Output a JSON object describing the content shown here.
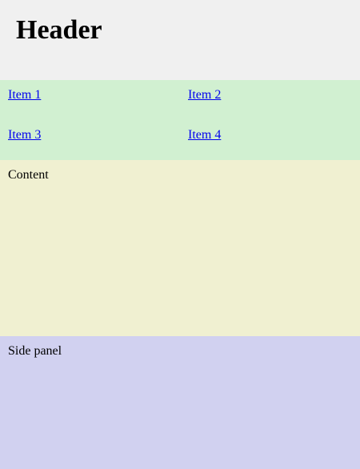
{
  "header": {
    "title": "Header"
  },
  "nav": {
    "items": [
      {
        "label": "Item 1"
      },
      {
        "label": "Item 2"
      },
      {
        "label": "Item 3"
      },
      {
        "label": "Item 4"
      }
    ]
  },
  "content": {
    "text": "Content"
  },
  "side_panel": {
    "text": "Side panel"
  },
  "colors": {
    "header_bg": "#f0f0f0",
    "nav_bg": "#d1f0d1",
    "content_bg": "#f0f0d1",
    "side_panel_bg": "#d1d1f0",
    "link": "#0000ee"
  }
}
